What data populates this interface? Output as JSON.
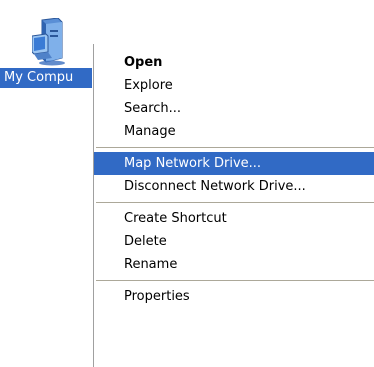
{
  "desktop": {
    "icon_label": "My Compu",
    "icon_name": "my-computer-icon"
  },
  "menu": {
    "group1": [
      "Open",
      "Explore",
      "Search...",
      "Manage"
    ],
    "group2": [
      "Map Network Drive...",
      "Disconnect Network Drive..."
    ],
    "group3": [
      "Create Shortcut",
      "Delete",
      "Rename"
    ],
    "group4": [
      "Properties"
    ],
    "highlighted_item": "Map Network Drive...",
    "default_item": "Open"
  },
  "colors": {
    "highlight": "#316ac5",
    "highlight_text": "#ffffff",
    "separator": "#aca899"
  }
}
